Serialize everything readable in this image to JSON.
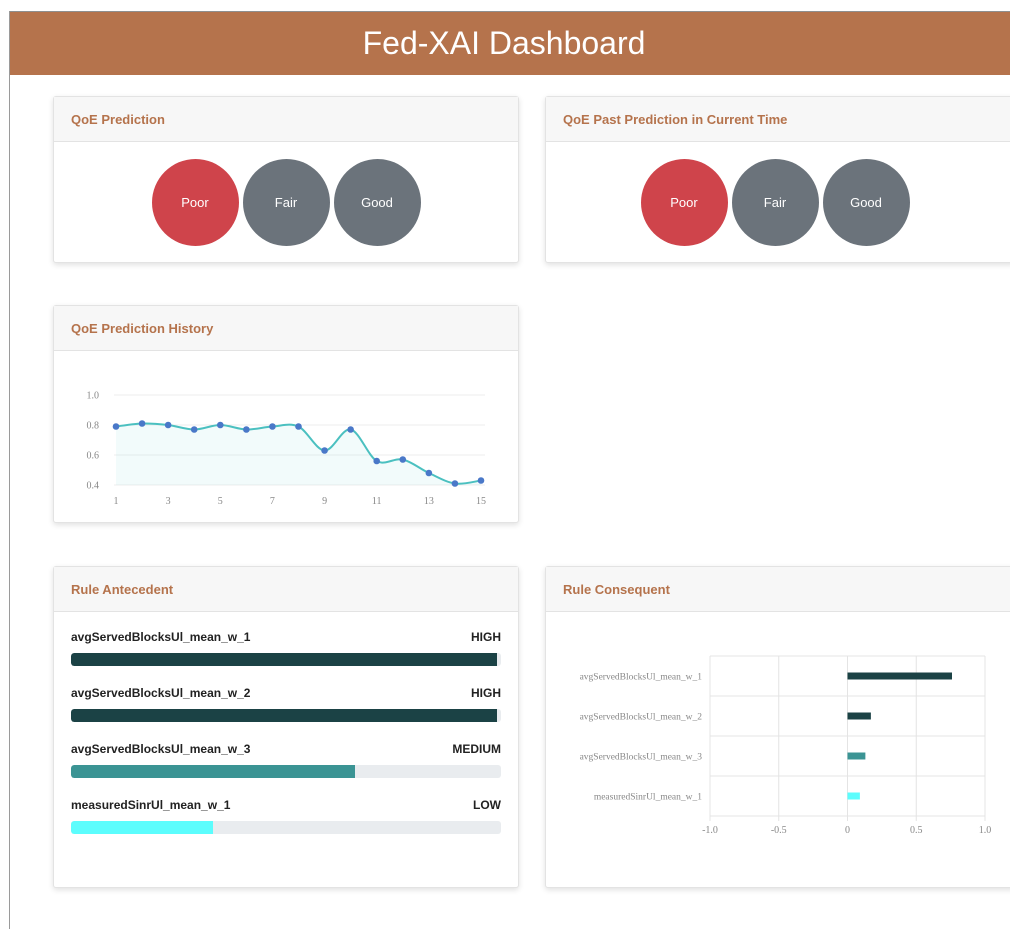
{
  "header": {
    "title": "Fed-XAI Dashboard"
  },
  "cards": {
    "prediction": {
      "title": "QoE Prediction",
      "options": [
        {
          "label": "Poor",
          "active": true
        },
        {
          "label": "Fair",
          "active": false
        },
        {
          "label": "Good",
          "active": false
        }
      ]
    },
    "past_prediction": {
      "title": "QoE Past Prediction in Current Time",
      "options": [
        {
          "label": "Poor",
          "active": true
        },
        {
          "label": "Fair",
          "active": false
        },
        {
          "label": "Good",
          "active": false
        }
      ]
    },
    "history": {
      "title": "QoE Prediction History"
    },
    "antecedent": {
      "title": "Rule Antecedent",
      "rules": [
        {
          "feature": "avgServedBlocksUl_mean_w_1",
          "level": "HIGH",
          "fill": 0.99,
          "color": "#1b4245"
        },
        {
          "feature": "avgServedBlocksUl_mean_w_2",
          "level": "HIGH",
          "fill": 0.99,
          "color": "#1b4245"
        },
        {
          "feature": "avgServedBlocksUl_mean_w_3",
          "level": "MEDIUM",
          "fill": 0.66,
          "color": "#3b9494"
        },
        {
          "feature": "measuredSinrUl_mean_w_1",
          "level": "LOW",
          "fill": 0.33,
          "color": "#5cfdfd"
        }
      ]
    },
    "consequent": {
      "title": "Rule Consequent"
    }
  },
  "chart_data": [
    {
      "type": "line",
      "x": [
        1,
        2,
        3,
        4,
        5,
        6,
        7,
        8,
        9,
        10,
        11,
        12,
        13,
        14,
        15
      ],
      "values": [
        0.79,
        0.81,
        0.8,
        0.77,
        0.8,
        0.77,
        0.79,
        0.79,
        0.63,
        0.77,
        0.56,
        0.57,
        0.48,
        0.41,
        0.43
      ],
      "xticks": [
        "1",
        "3",
        "5",
        "7",
        "9",
        "11",
        "13",
        "15"
      ],
      "yticks": [
        "0.4",
        "0.6",
        "0.8",
        "1.0"
      ],
      "ylim": [
        0.4,
        1.0
      ],
      "line_color": "#4bc0c0",
      "point_color": "#4a78c8",
      "grid": true
    },
    {
      "type": "bar",
      "orientation": "horizontal",
      "categories": [
        "avgServedBlocksUl_mean_w_1",
        "avgServedBlocksUl_mean_w_2",
        "avgServedBlocksUl_mean_w_3",
        "measuredSinrUl_mean_w_1"
      ],
      "values": [
        0.76,
        0.17,
        0.13,
        0.09
      ],
      "colors": [
        "#1b4245",
        "#1b4245",
        "#3b9494",
        "#5cfdfd"
      ],
      "xticks": [
        "-1.0",
        "-0.5",
        "0",
        "0.5",
        "1.0"
      ],
      "xlim": [
        -1.0,
        1.0
      ],
      "grid": true
    }
  ]
}
